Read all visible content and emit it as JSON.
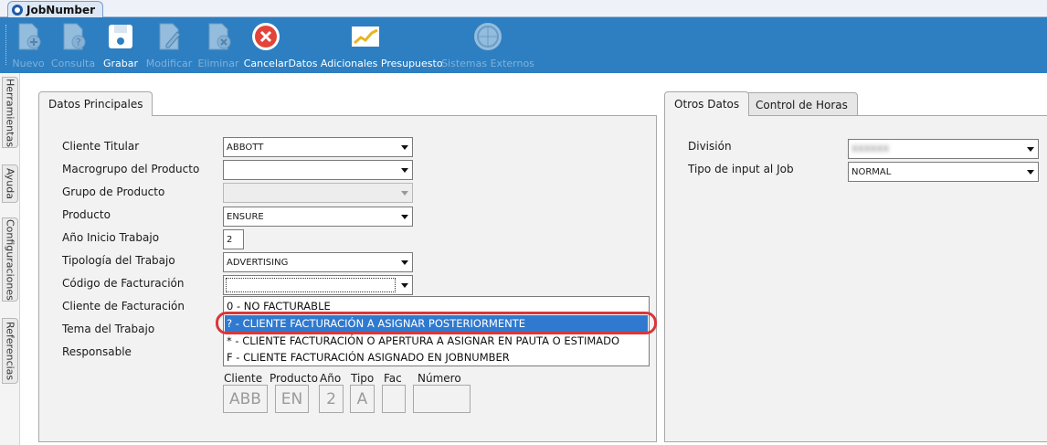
{
  "window": {
    "tab_title": "JobNumber"
  },
  "toolbar": {
    "buttons": [
      {
        "label": "Nuevo",
        "icon": "new-document-icon",
        "enabled": false
      },
      {
        "label": "Consulta",
        "icon": "query-document-icon",
        "enabled": false
      },
      {
        "label": "Grabar",
        "icon": "save-floppy-icon",
        "enabled": true
      },
      {
        "label": "Modificar",
        "icon": "edit-document-icon",
        "enabled": false
      },
      {
        "label": "Eliminar",
        "icon": "delete-document-icon",
        "enabled": false
      },
      {
        "label": "Cancelar",
        "icon": "cancel-circle-icon",
        "enabled": true
      },
      {
        "label": "Datos Adicionales Presupuesto",
        "icon": "chart-line-icon",
        "enabled": true
      },
      {
        "label": "Sistemas Externos",
        "icon": "globe-icon",
        "enabled": false
      }
    ]
  },
  "side_tabs": [
    "Herramientas",
    "Ayuda",
    "Configuraciones",
    "Referencias"
  ],
  "main_panel": {
    "tab": "Datos Principales",
    "fields": {
      "cliente_titular": {
        "label": "Cliente Titular",
        "value": "ABBOTT"
      },
      "macrogrupo": {
        "label": "Macrogrupo del Producto",
        "value": ""
      },
      "grupo": {
        "label": "Grupo de Producto",
        "value": ""
      },
      "producto": {
        "label": "Producto",
        "value": "ENSURE"
      },
      "anio_inicio": {
        "label": "Año Inicio Trabajo",
        "value": "2"
      },
      "tipologia": {
        "label": "Tipología del Trabajo",
        "value": "ADVERTISING"
      },
      "codigo_facturacion": {
        "label": "Código de Facturación",
        "value": ""
      },
      "cliente_facturacion": {
        "label": "Cliente de Facturación"
      },
      "tema": {
        "label": "Tema del Trabajo"
      },
      "responsable": {
        "label": "Responsable"
      }
    },
    "dropdown_options": [
      "0 - NO FACTURABLE",
      "? - CLIENTE FACTURACIÓN A ASIGNAR POSTERIORMENTE",
      "* - CLIENTE FACTURACIÓN O APERTURA A ASIGNAR EN PAUTA O ESTIMADO",
      "F - CLIENTE FACTURACIÓN ASIGNADO EN JOBNUMBER"
    ],
    "dropdown_selected_index": 1,
    "code": {
      "headers": [
        "Cliente",
        "Producto",
        "Año",
        "Tipo",
        "Fac",
        "Número"
      ],
      "values": [
        "ABB",
        "EN",
        "2",
        "A",
        "",
        ""
      ]
    }
  },
  "right_panel": {
    "tabs": [
      "Otros Datos",
      "Control de Horas"
    ],
    "fields": {
      "division": {
        "label": "División",
        "value": "XXXXXX"
      },
      "tipo_input": {
        "label": "Tipo de input al Job",
        "value": "NORMAL"
      }
    }
  },
  "colors": {
    "toolbar_bg": "#2d7fc1",
    "selection": "#2f7ad0",
    "highlight_ring": "#d9363b"
  }
}
